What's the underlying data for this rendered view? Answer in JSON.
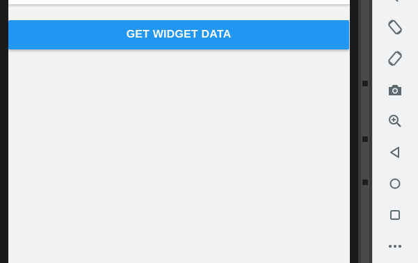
{
  "app": {
    "get_widget_button_label": "GET WIDGET DATA"
  },
  "emulator_toolbar": {
    "buttons": [
      {
        "name": "rotate-left",
        "icon": "rotate-left-icon"
      },
      {
        "name": "rotate-right",
        "icon": "rotate-right-icon"
      },
      {
        "name": "screenshot",
        "icon": "camera-icon"
      },
      {
        "name": "zoom",
        "icon": "zoom-in-icon"
      },
      {
        "name": "back",
        "icon": "back-triangle-icon"
      },
      {
        "name": "home",
        "icon": "home-circle-icon"
      },
      {
        "name": "overview",
        "icon": "overview-square-icon"
      },
      {
        "name": "more",
        "icon": "more-dots-icon"
      }
    ]
  },
  "colors": {
    "button": "#2196f3",
    "screen_background": "#f2f2f2",
    "toolbar_icon": "#5f6b73"
  }
}
